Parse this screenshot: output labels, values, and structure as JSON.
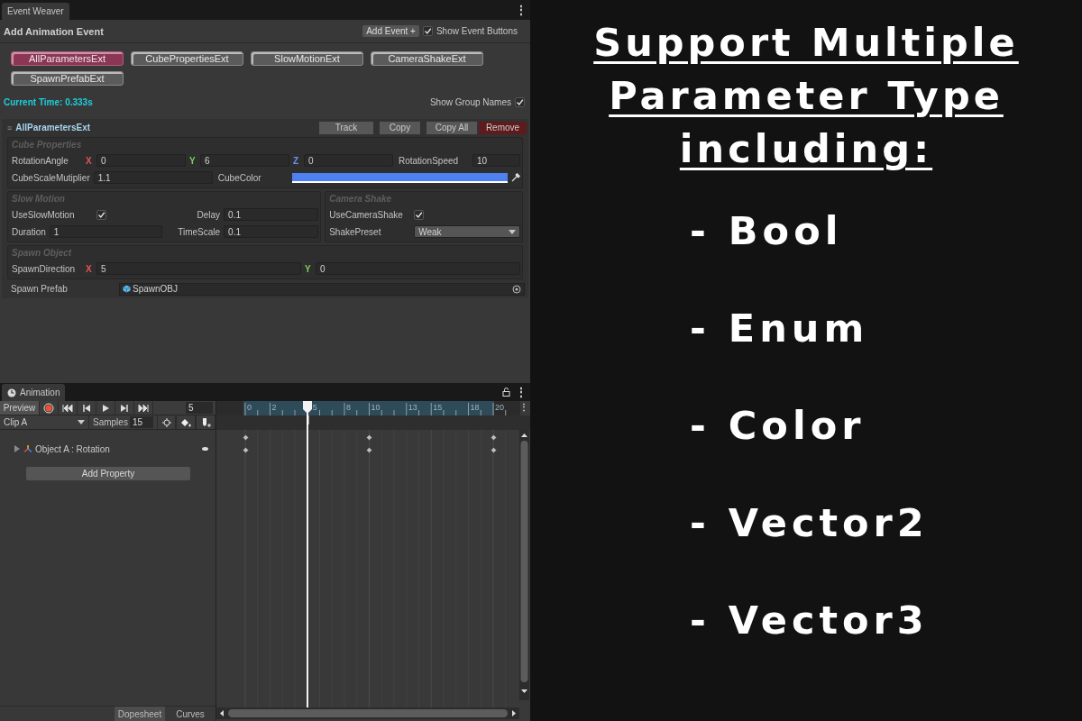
{
  "event_weaver": {
    "tab": "Event Weaver",
    "menu": "⋮",
    "title": "Add Animation Event",
    "add_button": "Add Event +",
    "show_event_buttons": {
      "label": "Show Event Buttons",
      "checked": true
    },
    "event_buttons": [
      {
        "label": "AllParametersExt",
        "selected": true
      },
      {
        "label": "CubePropertiesExt",
        "selected": false
      },
      {
        "label": "SlowMotionExt",
        "selected": false
      },
      {
        "label": "CameraShakeExt",
        "selected": false
      },
      {
        "label": "SpawnPrefabExt",
        "selected": false
      }
    ],
    "current_time": "Current Time: 0.333s",
    "show_group_names": {
      "label": "Show Group Names",
      "checked": true
    },
    "event": {
      "handle": "≡",
      "name": "AllParametersExt",
      "actions": [
        {
          "label": "Track",
          "kind": "normal"
        },
        {
          "label": "Copy",
          "kind": "normal"
        },
        {
          "label": "Copy All",
          "kind": "normal"
        },
        {
          "label": "Remove",
          "kind": "danger"
        }
      ],
      "sections": [
        {
          "groups": [
            {
              "title": "Cube Properties",
              "lines": [
                {
                  "fields": [
                    {
                      "kind": "vector3",
                      "label": "RotationAngle",
                      "components": [
                        {
                          "axis": "X",
                          "value": "0"
                        },
                        {
                          "axis": "Y",
                          "value": "6"
                        },
                        {
                          "axis": "Z",
                          "value": "0"
                        }
                      ]
                    },
                    {
                      "kind": "float",
                      "label": "RotationSpeed",
                      "value": "10"
                    }
                  ]
                },
                {
                  "fields": [
                    {
                      "kind": "float",
                      "label": "CubeScaleMutiplier",
                      "value": "1.1"
                    },
                    {
                      "kind": "color",
                      "label": "CubeColor",
                      "color": "#4f80f2"
                    }
                  ]
                }
              ]
            }
          ]
        },
        {
          "groups": [
            {
              "title": "Slow Motion",
              "lines": [
                {
                  "fields": [
                    {
                      "kind": "bool",
                      "label": "UseSlowMotion",
                      "checked": true
                    },
                    {
                      "kind": "float",
                      "label": "Delay",
                      "value": "0.1"
                    }
                  ]
                },
                {
                  "fields": [
                    {
                      "kind": "float",
                      "label": "Duration",
                      "value": "1"
                    },
                    {
                      "kind": "float",
                      "label": "TimeScale",
                      "value": "0.1"
                    }
                  ]
                }
              ]
            },
            {
              "title": "Camera Shake",
              "lines": [
                {
                  "fields": [
                    {
                      "kind": "bool",
                      "label": "UseCameraShake",
                      "checked": true
                    }
                  ]
                },
                {
                  "fields": [
                    {
                      "kind": "enum",
                      "label": "ShakePreset",
                      "value": "Weak"
                    }
                  ]
                }
              ]
            }
          ]
        },
        {
          "groups": [
            {
              "title": "Spawn Object",
              "lines": [
                {
                  "fields": [
                    {
                      "kind": "vector2",
                      "label": "SpawnDirection",
                      "components": [
                        {
                          "axis": "X",
                          "value": "5"
                        },
                        {
                          "axis": "Y",
                          "value": "0"
                        }
                      ]
                    }
                  ]
                }
              ]
            }
          ]
        }
      ],
      "prefab": {
        "label": "Spawn Prefab",
        "value": "SpawnOBJ"
      }
    }
  },
  "animation": {
    "tab": "Animation",
    "preview": "Preview",
    "frame": "5",
    "clip": "Clip A",
    "samples_label": "Samples",
    "samples": "15",
    "ruler_labels": [
      "0",
      "2",
      "5",
      "8",
      "10",
      "13",
      "15",
      "18",
      "20"
    ],
    "track": {
      "name": "Object A : Rotation",
      "expanded": false
    },
    "add_property": "Add Property",
    "view_tabs": [
      {
        "label": "Dopesheet",
        "selected": true
      },
      {
        "label": "Curves",
        "selected": false
      }
    ]
  },
  "promo": {
    "heading": "Support Multiple Parameter Type including:",
    "items": [
      "- Bool",
      "- Enum",
      "- Color",
      "- Vector2",
      "- Vector3"
    ]
  }
}
